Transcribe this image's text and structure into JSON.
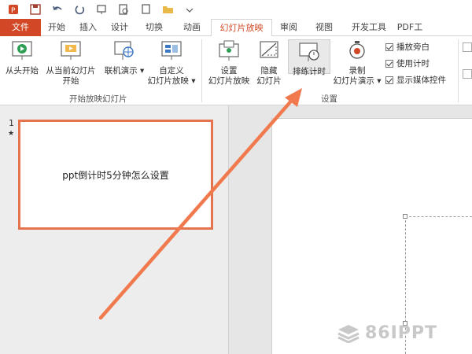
{
  "tabs": [
    "文件",
    "开始",
    "插入",
    "设计",
    "切换",
    "动画",
    "幻灯片放映",
    "审阅",
    "视图",
    "开发工具",
    "PDF工"
  ],
  "active_tab": "幻灯片放映",
  "ribbon": {
    "from_beginning": "从头开始",
    "from_current_l1": "从当前幻灯片",
    "from_current_l2": "开始",
    "online_present": "联机演示",
    "custom_l1": "自定义",
    "custom_l2": "幻灯片放映",
    "group_start": "开始放映幻灯片",
    "setup_l1": "设置",
    "setup_l2": "幻灯片放映",
    "hide_l1": "隐藏",
    "hide_l2": "幻灯片",
    "rehearse": "排练计时",
    "record_l1": "录制",
    "record_l2": "幻灯片演示",
    "group_setup": "设置",
    "check_narration": "播放旁白",
    "check_timings": "使用计时",
    "check_media": "显示媒体控件"
  },
  "slides": {
    "number": "1",
    "star": "★",
    "thumb_text": "ppt倒计时5分钟怎么设置"
  },
  "watermark": "86IPPT",
  "colors": {
    "accent": "#d24726",
    "arrow": "#f07a4e"
  }
}
